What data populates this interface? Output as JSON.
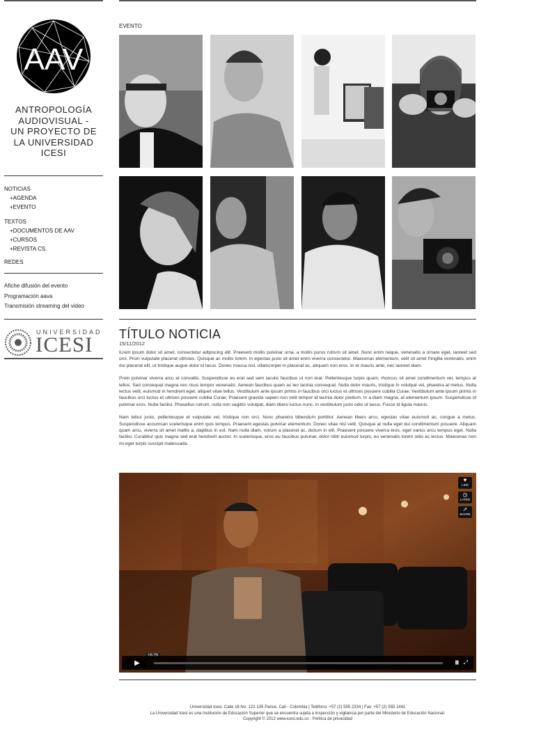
{
  "site": {
    "logo_text": "AAV",
    "title_lines": [
      "ANTROPOLOGÍA",
      "AUDIOVISUAL -",
      "UN PROYECTO DE",
      "LA UNIVERSIDAD",
      "ICESI"
    ]
  },
  "nav": {
    "noticias": "NOTICIAS",
    "agenda": "+AGENDA",
    "evento": "+EVENTO",
    "textos": "TEXTOS",
    "documentos": "+DOCUMENTOS DE AAV",
    "cursos": "+CURSOS",
    "revista": "+REVISTA CS",
    "redes": "REDES"
  },
  "links": {
    "afiche": "Afiche difusión del evento",
    "programacion": "Programación aava",
    "streaming": "Transmisión streaming del video"
  },
  "sponsor": {
    "small": "UNIVERSIDAD",
    "big": "ICESI"
  },
  "main": {
    "section_label": "EVENTO",
    "news_title": "TÍTULO NOTICIA",
    "news_date": "15/11/2012",
    "paragraphs": [
      "lLrem ipsum dolor sit amet, consectetur adipiscing elit. Praesent mollis pulvinar urna, a mollis purus rutrum sit amet. Nunc enim neque, venenatis a ornare eget, laoreet sed orci. Proin vulputate placerat ultricies. Quisque ac mollis lorem. In egestas justo sit amet enim viverra consectetur. Maecenas elementum, velit sit amet fringilla venenatis, enim dui placerat elit, ut tristique augue dolor id lacus. Donec massa nisl, ullamcorper in placerat ac, aliquam non eros. In et mauris ante, nec laoreet diam.",
      "Proin pulvinar viverra arcu at convallis. Suspendisse eu erat sed sem iaculis faucibus ut non erat. Pellentesque turpis quam, rhoncus sit amet condimentum vel, tempus at tellus. Sed consequat magna nec risus tempor venenatis. Aenean faucibus quam ac leo lacinia consequat. Nulla dolor mauris, tristique in volutpat vel, pharetra at metus. Nulla lectus velit, euismod in hendrerit eget, aliquet vitae tellus. Vestibulum ante ipsum primis in faucibus orci luctus et ultrices posuere cubilia Curae; Vestibulum ante ipsum primis in faucibus orci luctus et ultrices posuere cubilia Curae; Praesent gravida sapien non velit tempor id lacinia dolor pretium. In a diam magna, at elementum ipsum. Suspendisse id pulvinar eros. Nulla facilisi. Phasellus rutrum, nulla non sagittis volutpat, diam libero luctus nunc, in vestibulum justo odio ut lacus. Fusce id ligula mauris.",
      "Nam tellus justo, pellentesque et vulputate vel, tristique non orci. Nunc pharetra bibendum porttitor. Aenean libero arcu, egestas vitae euismod ac, congue a metus. Suspendisse accumsan scelerisque enim quis tempus. Praesent egestas pulvinar elementum. Donec vitae nisi velit. Quisque at nulla eget dui condimentum posuere. Aliquam quam arcu, viverra sit amet mattis a, dapibus in est. Nam nulla diam, rutrum a placerat ac, dictum in elit. Praesent posuere viverra eros, eget varius arcu tempus eget. Nulla facilisi. Curabitur quis magna sed erat hendrerit auctor. In scelerisque, eros eu faucibus pulvinar, dolor nibh euismod turpis, eu venenatis lorem odio ac lectus. Maecenas non mi eget turpis suscipit malesuada."
    ]
  },
  "video": {
    "like": "LIKE",
    "later": "LATER",
    "share": "SHARE",
    "time": "16:29"
  },
  "footer": {
    "line1": "Universidad Icesi, Calle 18 No. 122-135 Pance, Cali - Colombia | Teléfono: +57 (2) 555 2334 | Fax: +57 (2) 555 1441",
    "line2": "La Universidad Icesi es una Institución de Educación Superior que se encuentra sujeta a inspección y vigilancia por parte del Ministerio de Educación Nacional.",
    "line3": "Copyright © 2012 www.icesi.edu.co - Política de privacidad"
  },
  "icons": [
    "play-icon",
    "heart-icon",
    "clock-icon",
    "share-icon",
    "fullscreen-icon",
    "volume-icon"
  ]
}
